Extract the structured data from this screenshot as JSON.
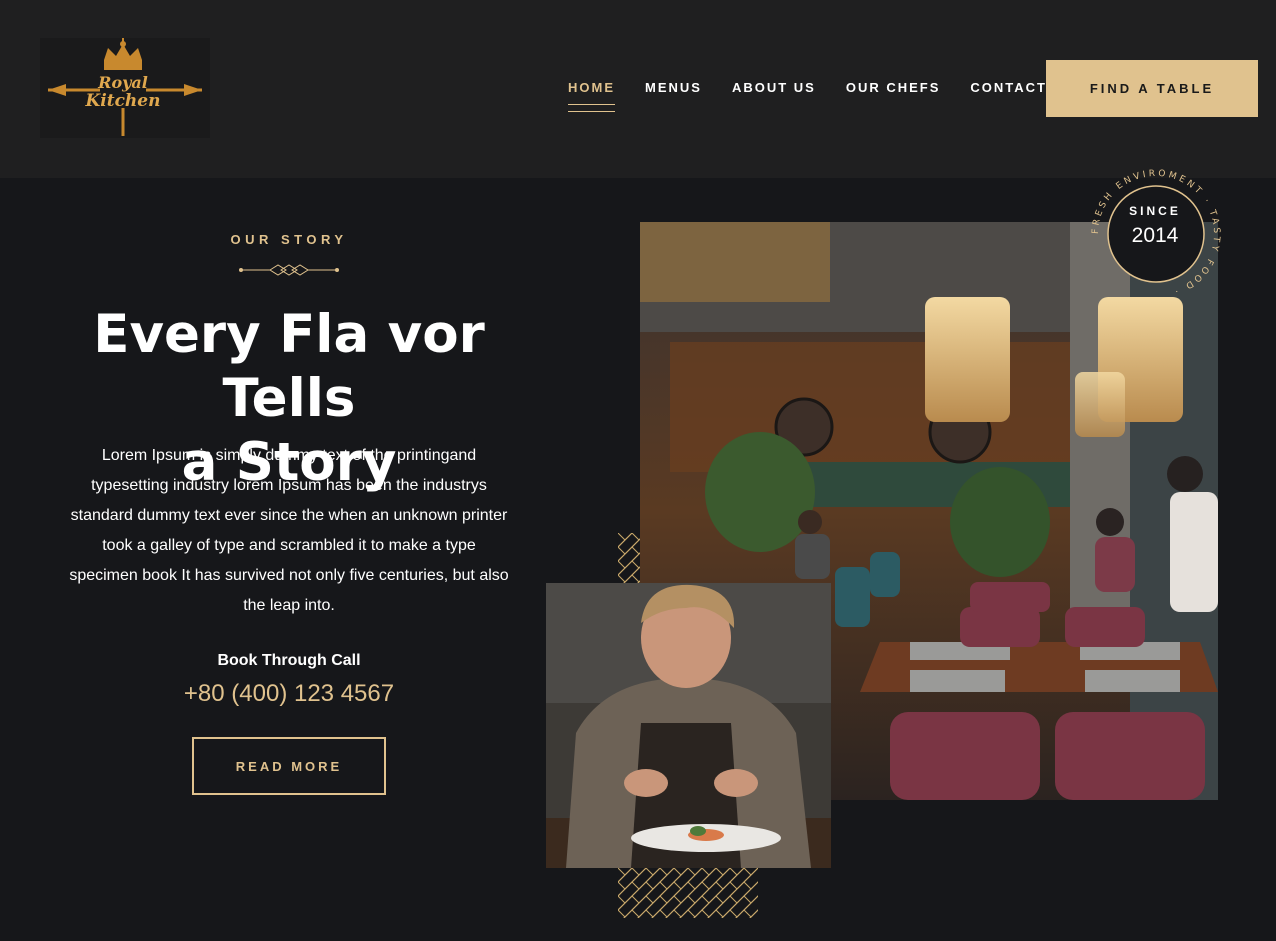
{
  "header": {
    "logo_alt": "Royal Kitchen",
    "nav": [
      "HOME",
      "MENUS",
      "ABOUT US",
      "OUR CHEFS",
      "CONTACT"
    ],
    "active_nav": "HOME",
    "cta_label": "FIND A TABLE"
  },
  "story": {
    "eyebrow": "OUR STORY",
    "title_line1": "Every Fla vor Tells",
    "title_line2": "a Story",
    "body": "Lorem Ipsum is simply dummy text of the printingand typesetting industry lorem Ipsum has been the industrys standard dummy text ever since the when an unknown printer took a galley of type and scrambled it to make a type specimen book It has survived not only five centuries, but also the leap into.",
    "call_label": "Book Through Call",
    "phone": "+80 (400) 123 4567",
    "read_more_label": "READ MORE"
  },
  "badge": {
    "since_label": "SINCE",
    "year": "2014",
    "ring_text": "FRESH ENVIROMENT · TASTY FOOD ·"
  },
  "colors": {
    "accent": "#e0c28e",
    "header_bg": "#1f1f20",
    "page_bg": "#16171a"
  }
}
